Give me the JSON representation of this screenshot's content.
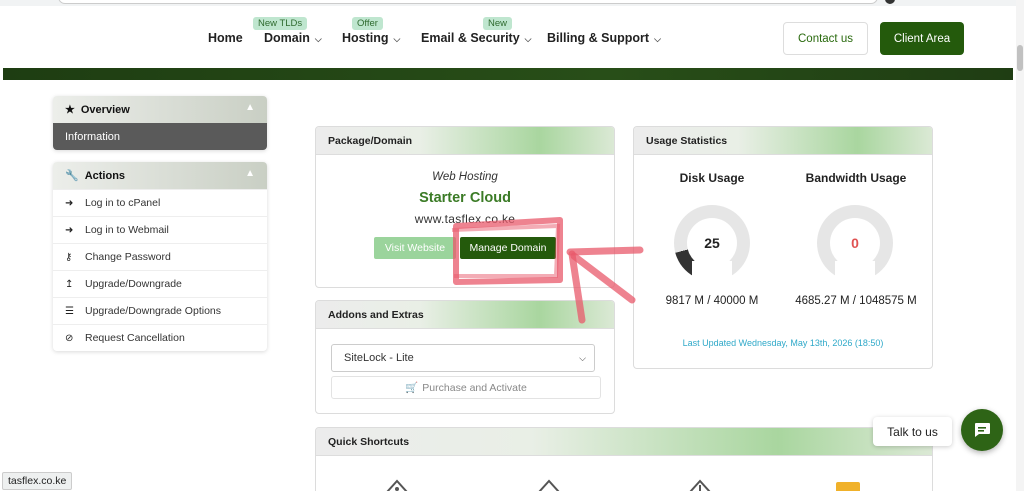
{
  "nav": {
    "home": "Home",
    "domain": "Domain",
    "domain_badge": "New TLDs",
    "hosting": "Hosting",
    "hosting_badge": "Offer",
    "email": "Email & Security",
    "email_badge": "New",
    "billing": "Billing & Support",
    "contact": "Contact us",
    "client_area": "Client Area"
  },
  "sidebar": {
    "overview_title": "Overview",
    "information": "Information",
    "actions_title": "Actions",
    "actions": [
      {
        "label": "Log in to cPanel",
        "icon": "sign-in-icon"
      },
      {
        "label": "Log in to Webmail",
        "icon": "sign-in-icon"
      },
      {
        "label": "Change Password",
        "icon": "key-icon"
      },
      {
        "label": "Upgrade/Downgrade",
        "icon": "arrow-up-icon"
      },
      {
        "label": "Upgrade/Downgrade Options",
        "icon": "list-icon"
      },
      {
        "label": "Request Cancellation",
        "icon": "ban-icon"
      }
    ]
  },
  "package": {
    "title": "Package/Domain",
    "type": "Web Hosting",
    "name": "Starter Cloud",
    "domain": "www.tasflex.co.ke",
    "visit_label": "Visit Website",
    "manage_label": "Manage Domain"
  },
  "addons": {
    "title": "Addons and Extras",
    "selected": "SiteLock - Lite",
    "purchase_label": "Purchase and Activate"
  },
  "usage": {
    "title": "Usage Statistics",
    "disk_title": "Disk Usage",
    "disk_percent": "25",
    "disk_value": "9817 M / 40000 M",
    "bw_title": "Bandwidth Usage",
    "bw_percent": "0",
    "bw_value": "4685.27 M / 1048575 M",
    "last_updated": "Last Updated Wednesday, May 13th, 2026 (18:50)"
  },
  "shortcuts": {
    "title": "Quick Shortcuts"
  },
  "chat": {
    "talk_label": "Talk to us"
  },
  "status_bar": {
    "url": "tasflex.co.ke"
  },
  "colors": {
    "brand_green": "#245a0c",
    "accent_green": "#3b7b26",
    "link_blue": "#2fa9c9",
    "annotation_red": "#e85a6b"
  }
}
